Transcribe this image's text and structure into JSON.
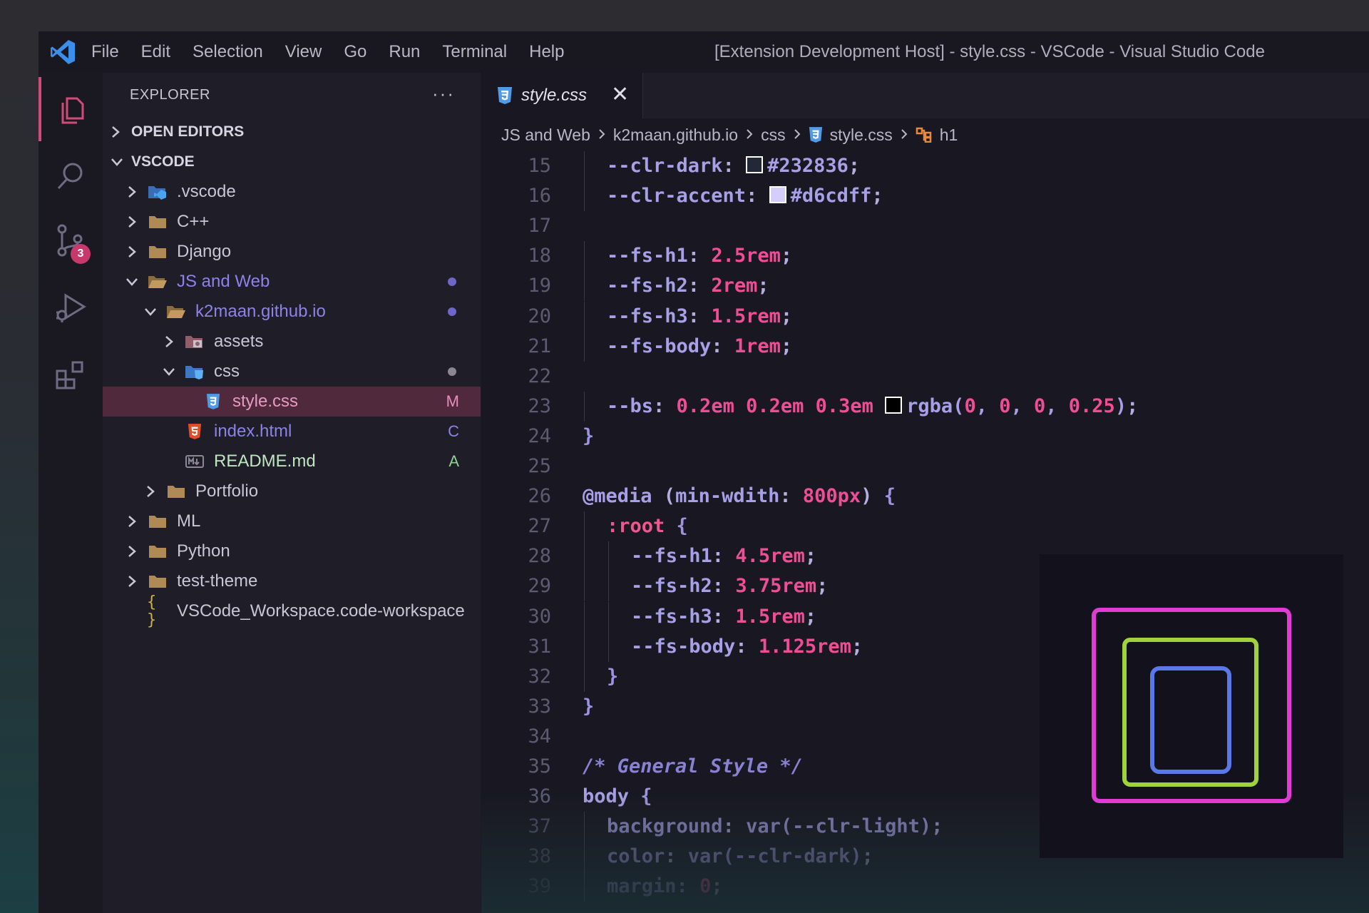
{
  "colors": {
    "accent": "#d04b78",
    "vscode_blue": "#3b8eea",
    "css_icon": "#4f9be8",
    "html_icon": "#e34c26",
    "preview_outer": "#e23bd2",
    "preview_middle": "#9fd23b",
    "preview_inner": "#5a78e8"
  },
  "titlebar": {
    "menu": [
      "File",
      "Edit",
      "Selection",
      "View",
      "Go",
      "Run",
      "Terminal",
      "Help"
    ],
    "window_title": "[Extension Development Host] - style.css - VSCode - Visual Studio Code"
  },
  "activitybar": {
    "items": [
      "files-icon",
      "search-icon",
      "source-control-icon",
      "run-debug-icon",
      "extensions-icon"
    ],
    "scm_badge": "3"
  },
  "sidebar": {
    "title": "EXPLORER",
    "more": "···",
    "open_editors": "OPEN EDITORS",
    "workspace": "VSCODE",
    "tree": [
      {
        "label": ".vscode",
        "expanded": false,
        "icon": "vscode-folder-icon"
      },
      {
        "label": "C++",
        "expanded": false,
        "icon": "folder-icon"
      },
      {
        "label": "Django",
        "expanded": false,
        "icon": "folder-icon"
      },
      {
        "label": "JS and Web",
        "expanded": true,
        "icon": "folder-open-icon"
      },
      {
        "label": "k2maan.github.io",
        "expanded": true,
        "icon": "folder-open-icon"
      },
      {
        "label": "assets",
        "expanded": false,
        "icon": "assets-folder-icon"
      },
      {
        "label": "css",
        "expanded": true,
        "icon": "css-folder-icon"
      },
      {
        "label": "style.css",
        "status": "M",
        "icon": "css-file-icon"
      },
      {
        "label": "index.html",
        "status": "C",
        "icon": "html-file-icon"
      },
      {
        "label": "README.md",
        "status": "A",
        "icon": "markdown-file-icon"
      },
      {
        "label": "Portfolio",
        "expanded": false,
        "icon": "folder-icon"
      },
      {
        "label": "ML",
        "expanded": false,
        "icon": "folder-icon"
      },
      {
        "label": "Python",
        "expanded": false,
        "icon": "folder-icon"
      },
      {
        "label": "test-theme",
        "expanded": false,
        "icon": "folder-icon"
      },
      {
        "label": "VSCode_Workspace.code-workspace",
        "icon": "json-braces-icon"
      }
    ]
  },
  "editor": {
    "tab": {
      "label": "style.css",
      "close": "✕"
    },
    "breadcrumb": [
      "JS and Web",
      "k2maan.github.io",
      "css",
      "style.css",
      "h1"
    ],
    "lines": [
      {
        "n": "15",
        "t": [
          [
            "p",
            "--clr-dark"
          ],
          [
            "u",
            ": "
          ],
          [
            "sw",
            "#232836"
          ],
          [
            "p",
            "#232836"
          ],
          [
            "u",
            ";"
          ]
        ]
      },
      {
        "n": "16",
        "t": [
          [
            "p",
            "--clr-accent"
          ],
          [
            "u",
            ": "
          ],
          [
            "sw",
            "#d6cdff"
          ],
          [
            "p",
            "#d6cdff"
          ],
          [
            "u",
            ";"
          ]
        ]
      },
      {
        "n": "17",
        "t": []
      },
      {
        "n": "18",
        "t": [
          [
            "p",
            "--fs-h1"
          ],
          [
            "u",
            ": "
          ],
          [
            "n",
            "2.5rem"
          ],
          [
            "u",
            ";"
          ]
        ]
      },
      {
        "n": "19",
        "t": [
          [
            "p",
            "--fs-h2"
          ],
          [
            "u",
            ": "
          ],
          [
            "n",
            "2rem"
          ],
          [
            "u",
            ";"
          ]
        ]
      },
      {
        "n": "20",
        "t": [
          [
            "p",
            "--fs-h3"
          ],
          [
            "u",
            ": "
          ],
          [
            "n",
            "1.5rem"
          ],
          [
            "u",
            ";"
          ]
        ]
      },
      {
        "n": "21",
        "t": [
          [
            "p",
            "--fs-body"
          ],
          [
            "u",
            ": "
          ],
          [
            "n",
            "1rem"
          ],
          [
            "u",
            ";"
          ]
        ]
      },
      {
        "n": "22",
        "t": []
      },
      {
        "n": "23",
        "t": [
          [
            "p",
            "--bs"
          ],
          [
            "u",
            ": "
          ],
          [
            "n",
            "0.2em 0.2em 0.3em "
          ],
          [
            "sw",
            "#000000"
          ],
          [
            "p",
            "rgba("
          ],
          [
            "n",
            "0"
          ],
          [
            "p",
            ", "
          ],
          [
            "n",
            "0"
          ],
          [
            "p",
            ", "
          ],
          [
            "n",
            "0"
          ],
          [
            "p",
            ", "
          ],
          [
            "n",
            "0.25"
          ],
          [
            "p",
            ")"
          ],
          [
            "u",
            ";"
          ]
        ]
      },
      {
        "n": "24",
        "t": [
          [
            "b",
            "}"
          ]
        ]
      },
      {
        "n": "25",
        "t": []
      },
      {
        "n": "26",
        "t": [
          [
            "k",
            "@media"
          ],
          [
            "u",
            " ("
          ],
          [
            "p",
            "min-wdith"
          ],
          [
            "u",
            ": "
          ],
          [
            "n",
            "800px"
          ],
          [
            "u",
            ") "
          ],
          [
            "b",
            "{"
          ]
        ]
      },
      {
        "n": "27",
        "t": [
          [
            "s",
            ":root"
          ],
          [
            "u",
            " "
          ],
          [
            "b",
            "{"
          ]
        ]
      },
      {
        "n": "28",
        "t": [
          [
            "p",
            "--fs-h1"
          ],
          [
            "u",
            ": "
          ],
          [
            "n",
            "4.5rem"
          ],
          [
            "u",
            ";"
          ]
        ]
      },
      {
        "n": "29",
        "t": [
          [
            "p",
            "--fs-h2"
          ],
          [
            "u",
            ": "
          ],
          [
            "n",
            "3.75rem"
          ],
          [
            "u",
            ";"
          ]
        ]
      },
      {
        "n": "30",
        "t": [
          [
            "p",
            "--fs-h3"
          ],
          [
            "u",
            ": "
          ],
          [
            "n",
            "1.5rem"
          ],
          [
            "u",
            ";"
          ]
        ]
      },
      {
        "n": "31",
        "t": [
          [
            "p",
            "--fs-body"
          ],
          [
            "u",
            ": "
          ],
          [
            "n",
            "1.125rem"
          ],
          [
            "u",
            ";"
          ]
        ]
      },
      {
        "n": "32",
        "t": [
          [
            "b",
            "}"
          ]
        ]
      },
      {
        "n": "33",
        "t": [
          [
            "b",
            "}"
          ]
        ]
      },
      {
        "n": "34",
        "t": []
      },
      {
        "n": "35",
        "t": [
          [
            "c",
            "/* General Style */"
          ]
        ]
      },
      {
        "n": "36",
        "t": [
          [
            "k",
            "body"
          ],
          [
            "u",
            " "
          ],
          [
            "b",
            "{"
          ]
        ]
      },
      {
        "n": "37",
        "t": [
          [
            "p",
            "background"
          ],
          [
            "u",
            ": "
          ],
          [
            "p",
            "var(--clr-light)"
          ],
          [
            "u",
            ";"
          ]
        ]
      },
      {
        "n": "38",
        "t": [
          [
            "p",
            "color"
          ],
          [
            "u",
            ": "
          ],
          [
            "p",
            "var(--clr-dark)"
          ],
          [
            "u",
            ";"
          ]
        ]
      },
      {
        "n": "39",
        "t": [
          [
            "p",
            "margin"
          ],
          [
            "u",
            ": "
          ],
          [
            "n",
            "0"
          ],
          [
            "u",
            ";"
          ]
        ]
      }
    ],
    "indent": {
      "15": 1,
      "16": 1,
      "18": 1,
      "19": 1,
      "20": 1,
      "21": 1,
      "23": 1,
      "24": 0,
      "26": 0,
      "27": 1,
      "28": 2,
      "29": 2,
      "30": 2,
      "31": 2,
      "32": 1,
      "33": 0,
      "35": 0,
      "36": 0,
      "37": 1,
      "38": 1,
      "39": 1
    }
  }
}
